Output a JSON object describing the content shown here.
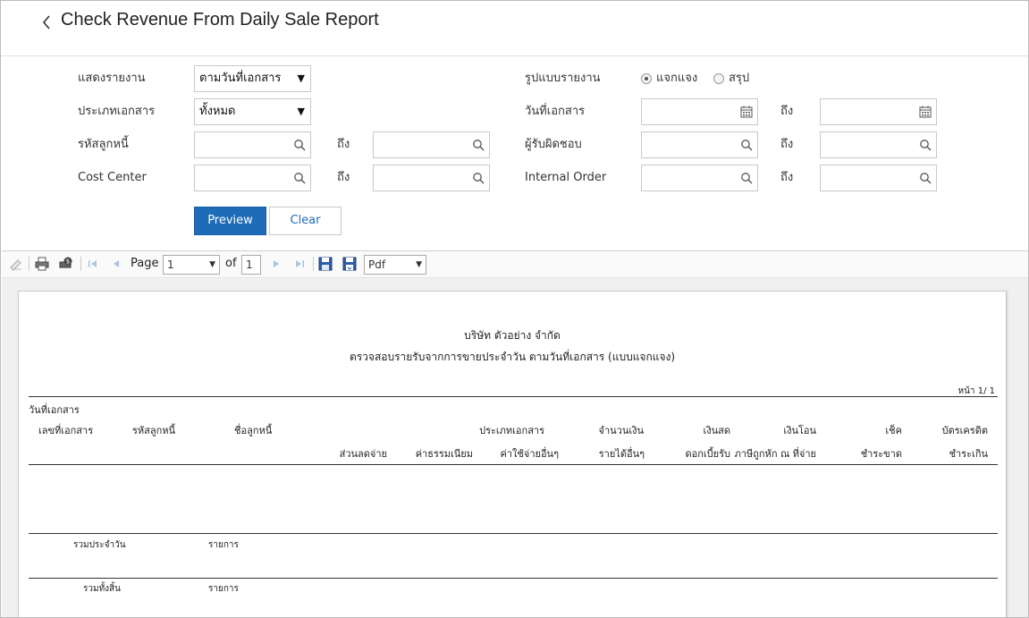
{
  "header": {
    "title": "Check Revenue From Daily Sale Report"
  },
  "form": {
    "show_report_label": "แสดงรายงาน",
    "show_report_value": "ตามวันที่เอกสาร",
    "doc_type_label": "ประเภทเอกสาร",
    "doc_type_value": "ทั้งหมด",
    "debtor_code_label": "รหัสลูกหนี้",
    "cost_center_label": "Cost Center",
    "to_label": "ถึง",
    "report_format_label": "รูปแบบรายงาน",
    "format_options": [
      {
        "label": "แจกแจง",
        "selected": true
      },
      {
        "label": "สรุป",
        "selected": false
      }
    ],
    "doc_date_label": "วันที่เอกสาร",
    "responsible_label": "ผู้รับผิดชอบ",
    "internal_order_label": "Internal Order",
    "preview_button": "Preview",
    "clear_button": "Clear"
  },
  "toolbar": {
    "page_label": "Page",
    "page_value": "1",
    "of_label": "of",
    "total_pages": "1",
    "export_format": "Pdf"
  },
  "report": {
    "company": "บริษัท ตัวอย่าง จำกัด",
    "title": "ตรวจสอบรายรับจากการขายประจำวัน ตามวันที่เอกสาร (แบบแจกแจง)",
    "page_info": "หน้า 1/ 1",
    "col_doc_date": "วันที่เอกสาร",
    "col_doc_no": "เลขที่เอกสาร",
    "col_debtor_code": "รหัสลูกหนี้",
    "col_debtor_name": "ชื่อลูกหนี้",
    "col_doc_type": "ประเภทเอกสาร",
    "col_amount": "จำนวนเงิน",
    "col_cash": "เงินสด",
    "col_transfer": "เงินโอน",
    "col_cheque": "เช็ค",
    "col_credit_card": "บัตรเครดิต",
    "col_discount": "ส่วนลดจ่าย",
    "col_fee": "ค่าธรรมเนียม",
    "col_other_expense": "ค่าใช้จ่ายอื่นๆ",
    "col_other_income": "รายได้อื่นๆ",
    "col_interest": "ดอกเบี้ยรับ",
    "col_wht": "ภาษีถูกหัก ณ ที่จ่าย",
    "col_cheque_bounce": "ชำระขาด",
    "col_overpay": "ชำระเกิน",
    "daily_total": "รวมประจำวัน",
    "grand_total": "รวมทั้งสิ้น",
    "items_label": "รายการ"
  }
}
